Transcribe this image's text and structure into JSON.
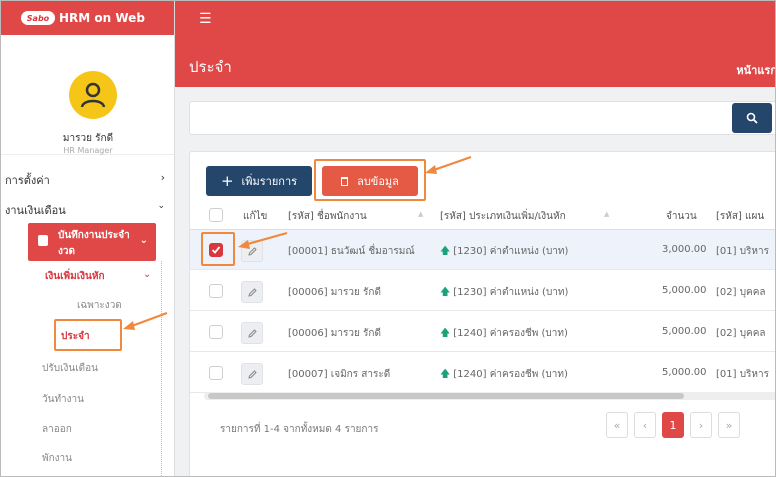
{
  "app": {
    "logo_text": "Sabo",
    "name": "HRM on Web"
  },
  "user": {
    "name": "มารวย รักดี",
    "role": "HR Manager"
  },
  "sidebar": {
    "settings_label": "การตั้งค่า",
    "payroll_label": "งานเงินเดือน",
    "period_line1": "บันทึกงานประจำ",
    "period_line2": "งวด",
    "addded_label": "เงินเพิ่มเงินหัก",
    "sub_items": [
      "เฉพาะงวด",
      "ประจำ",
      "ปรับเงินเดือน",
      "วันทำงาน",
      "ลาออก",
      "พักงาน"
    ]
  },
  "header": {
    "page_title": "ประจำ",
    "home_link": "หน้าแรก"
  },
  "search": {
    "placeholder": ""
  },
  "toolbar": {
    "add_label": "เพิ่มรายการ",
    "delete_label": "ลบข้อมูล"
  },
  "table": {
    "columns": [
      "แก้ไข",
      "[รหัส] ชื่อพนักงาน",
      "[รหัส] ประเภทเงินเพิ่ม/เงินหัก",
      "จำนวน",
      "[รหัส] แผน"
    ],
    "rows": [
      {
        "checked": true,
        "employee": "[00001] ธนวัฒน์ ชื่มอารมณ์",
        "type": "[1230] ค่าตำแหน่ง (บาท)",
        "amount": "3,000.00",
        "dept": "[01] บริหาร"
      },
      {
        "checked": false,
        "employee": "[00006] มารวย รักดี",
        "type": "[1230] ค่าตำแหน่ง (บาท)",
        "amount": "5,000.00",
        "dept": "[02] บุคคล"
      },
      {
        "checked": false,
        "employee": "[00006] มารวย รักดี",
        "type": "[1240] ค่าครองชีพ (บาท)",
        "amount": "5,000.00",
        "dept": "[02] บุคคล"
      },
      {
        "checked": false,
        "employee": "[00007] เจมิกร สาระดี",
        "type": "[1240] ค่าครองชีพ (บาท)",
        "amount": "5,000.00",
        "dept": "[01] บริหาร"
      }
    ],
    "footer": "รายการที่ 1-4 จากทั้งหมด 4 รายการ"
  },
  "pagination": {
    "first": "«",
    "prev": "‹",
    "current": "1",
    "next": "›",
    "last": "»"
  },
  "colors": {
    "brand_red": "#e04848",
    "navy": "#24466b",
    "delete_orange": "#e55a44",
    "highlight": "#f0883e",
    "arrow_green": "#1aa37a"
  }
}
